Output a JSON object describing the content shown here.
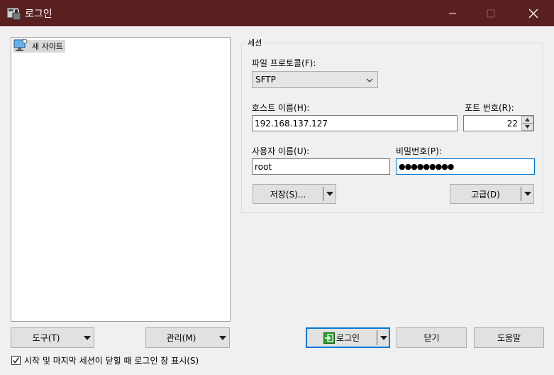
{
  "window": {
    "title": "로그인",
    "title_bar_color": "#5a2020"
  },
  "site_tree": {
    "items": [
      {
        "label": "새 사이트",
        "icon": "monitor-icon"
      }
    ]
  },
  "session": {
    "group_title": "세션",
    "protocol": {
      "label": "파일 프로토콜(F):",
      "value": "SFTP"
    },
    "host": {
      "label": "호스트 이름(H):",
      "value": "192.168.137.127"
    },
    "port": {
      "label": "포트 번호(R):",
      "value": "22"
    },
    "username": {
      "label": "사용자 이름(U):",
      "value": "root"
    },
    "password": {
      "label": "비밀번호(P):",
      "value": "●●●●●●●●●"
    },
    "save_button": "저장(S)...",
    "advanced_button": "고급(D)"
  },
  "bottom": {
    "tools_button": "도구(T)",
    "manage_button": "관리(M)",
    "login_button": "로그인",
    "close_button": "닫기",
    "help_button": "도움말",
    "show_login_checkbox": {
      "label": "시작 및 마지막 세션이 닫힐 때 로그인 창 표시(S)",
      "checked": true
    }
  },
  "colors": {
    "accent": "#0078d7",
    "login_icon_green": "#2aa02a"
  }
}
